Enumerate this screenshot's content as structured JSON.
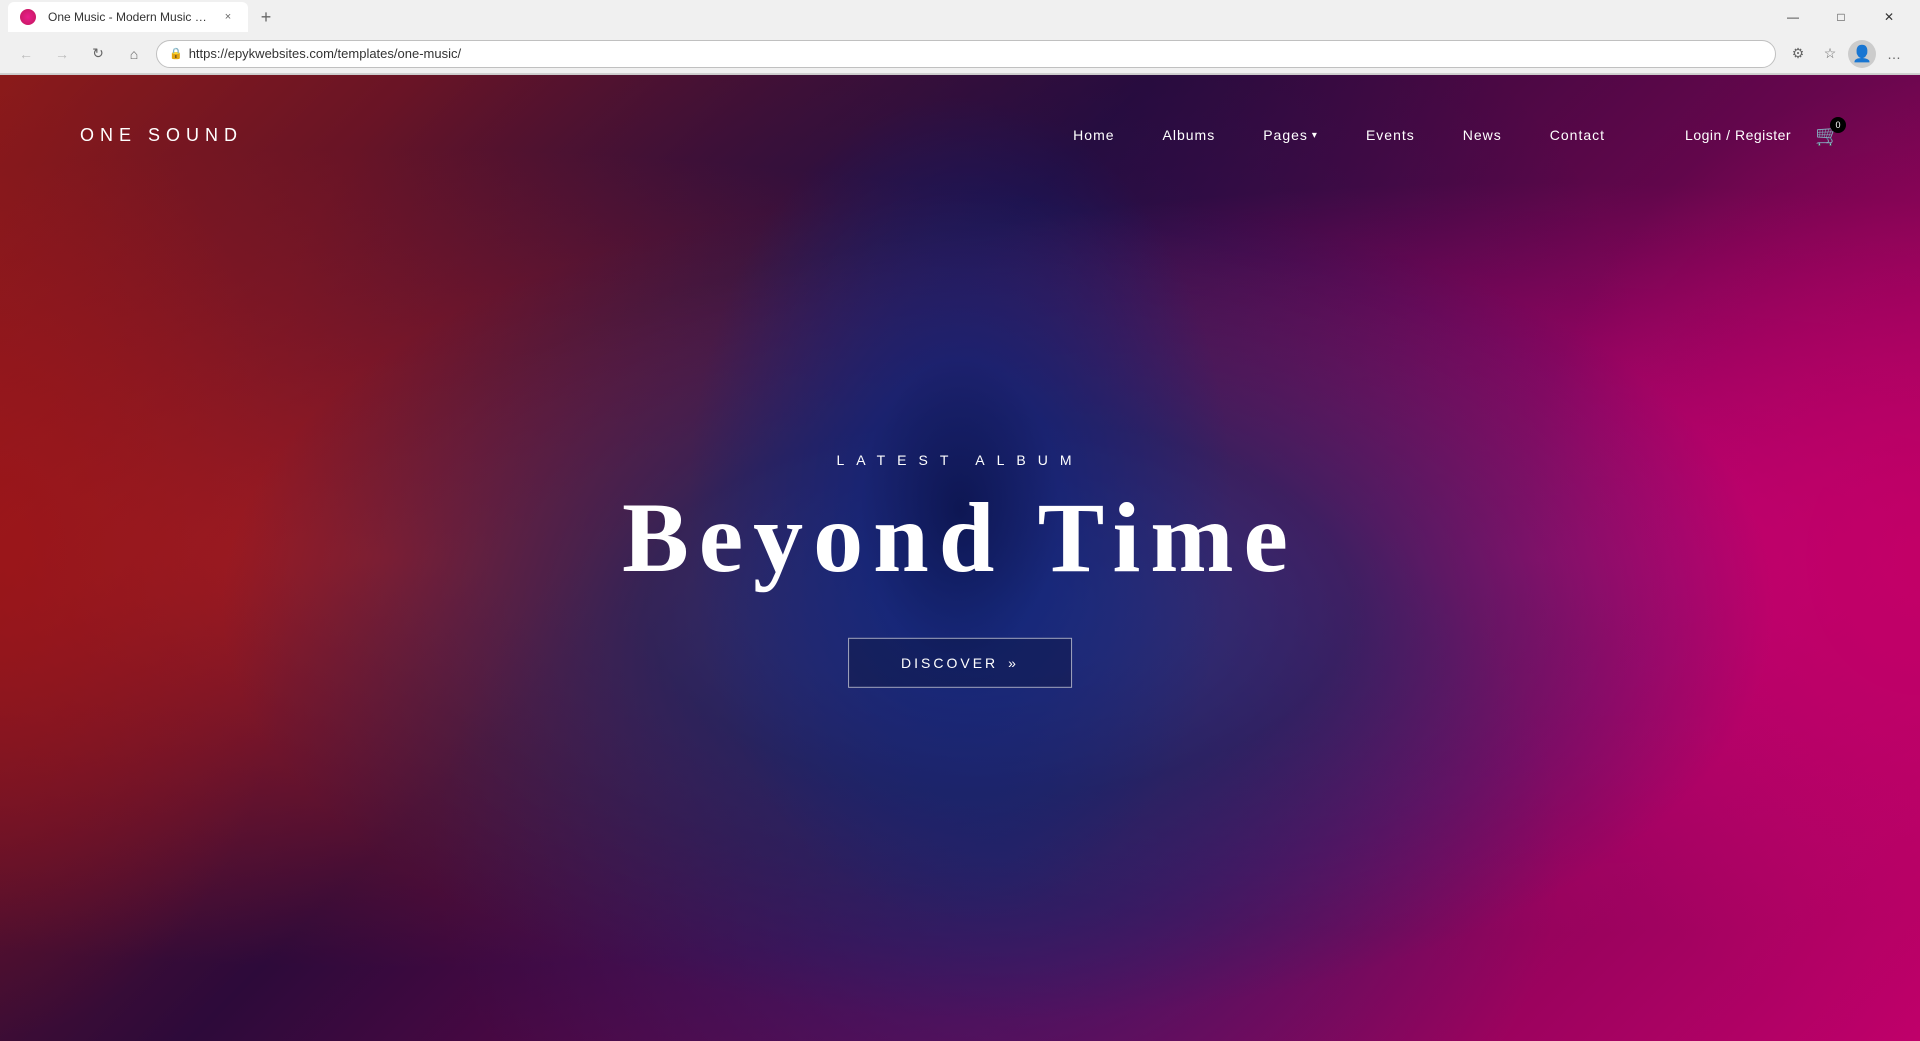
{
  "browser": {
    "tab": {
      "favicon_color": "#e91e8c",
      "title": "One Music - Modern Music HTM",
      "close_label": "×"
    },
    "new_tab_label": "+",
    "address": "https://epykwebsites.com/templates/one-music/",
    "nav": {
      "back_label": "←",
      "forward_label": "→",
      "refresh_label": "↻",
      "home_label": "⌂"
    },
    "window_controls": {
      "minimize": "—",
      "maximize": "□",
      "close": "✕"
    },
    "toolbar_icons": {
      "extensions": "⊞",
      "profile": "👤",
      "menu": "…"
    }
  },
  "site": {
    "logo": "ONE SOUND",
    "nav_links": [
      {
        "label": "Home",
        "has_dropdown": false
      },
      {
        "label": "Albums",
        "has_dropdown": false
      },
      {
        "label": "Pages",
        "has_dropdown": true
      },
      {
        "label": "Events",
        "has_dropdown": false
      },
      {
        "label": "News",
        "has_dropdown": false
      },
      {
        "label": "Contact",
        "has_dropdown": false
      }
    ],
    "login_label": "Login / Register",
    "cart_count": "0",
    "hero": {
      "subtitle": "LATEST ALBUM",
      "title": "Beyond Time",
      "cta_label": "Discover",
      "cta_chevrons": "»"
    }
  }
}
